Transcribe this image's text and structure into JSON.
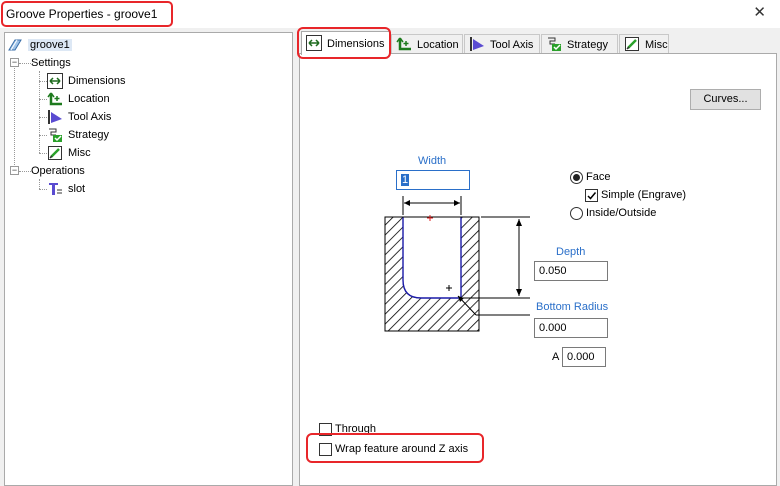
{
  "window": {
    "title": "Groove Properties - groove1",
    "close_glyph": "✕"
  },
  "tree": {
    "root": "groove1",
    "settings": "Settings",
    "settings_items": [
      "Dimensions",
      "Location",
      "Tool Axis",
      "Strategy",
      "Misc"
    ],
    "operations": "Operations",
    "operations_items": [
      "slot"
    ]
  },
  "tabs": [
    "Dimensions",
    "Location",
    "Tool Axis",
    "Strategy",
    "Misc"
  ],
  "active_tab": "Dimensions",
  "dimensions": {
    "curves_button": "Curves...",
    "width_label": "Width",
    "width_value": "1",
    "depth_label": "Depth",
    "depth_value": "0.050",
    "bottom_radius_label": "Bottom Radius",
    "bottom_radius_value": "0.000",
    "angle_label": "A",
    "angle_value": "0.000",
    "face_label": "Face",
    "face_selected": true,
    "simple_engrave_label": "Simple (Engrave)",
    "simple_engrave_checked": true,
    "inside_outside_label": "Inside/Outside",
    "through_label": "Through",
    "through_checked": false,
    "wrap_label": "Wrap feature around Z axis",
    "wrap_checked": false
  },
  "colors": {
    "highlight": "#e8262a",
    "label_blue": "#2a6fc9"
  }
}
